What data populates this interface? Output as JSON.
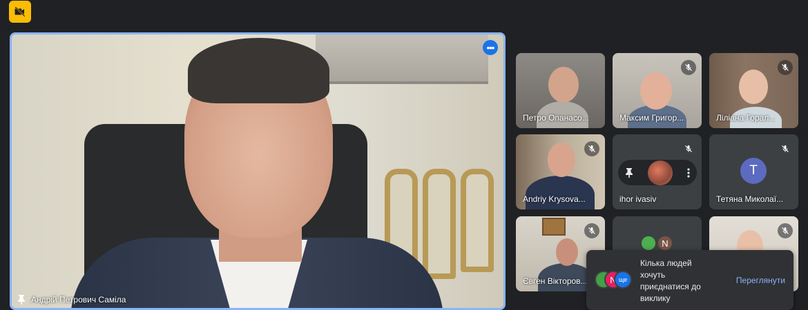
{
  "toolbar": {
    "camera_off_icon": "camera-off-icon"
  },
  "main_speaker": {
    "name": "Андрій Петрович Саміла",
    "pin_icon": "pin-icon",
    "more_icon": "more-horizontal-icon",
    "highlight_color": "#8ab4f8"
  },
  "participants": [
    {
      "name": "Петро Опанасо...",
      "muted": false
    },
    {
      "name": "Максим Григор...",
      "muted": true
    },
    {
      "name": "Лілiана Горал...",
      "muted": true
    },
    {
      "name": "Andriy Krysova...",
      "muted": true
    },
    {
      "name": "ihor ivasiv",
      "muted": true
    },
    {
      "name": "Тетяна Миколаї...",
      "muted": true,
      "initial": "T"
    },
    {
      "name": "Євген Вікторов...",
      "muted": true
    },
    {
      "name": "",
      "muted": false,
      "initial": "N"
    },
    {
      "name": "",
      "muted": true
    }
  ],
  "toast": {
    "message": "Кілька людей хочуть приєднатися до виклику",
    "action": "Переглянути",
    "avatar_letter": "N",
    "more_badge": "ще"
  },
  "colors": {
    "background": "#202124",
    "accent": "#8ab4f8",
    "alert": "#fbbc04"
  }
}
